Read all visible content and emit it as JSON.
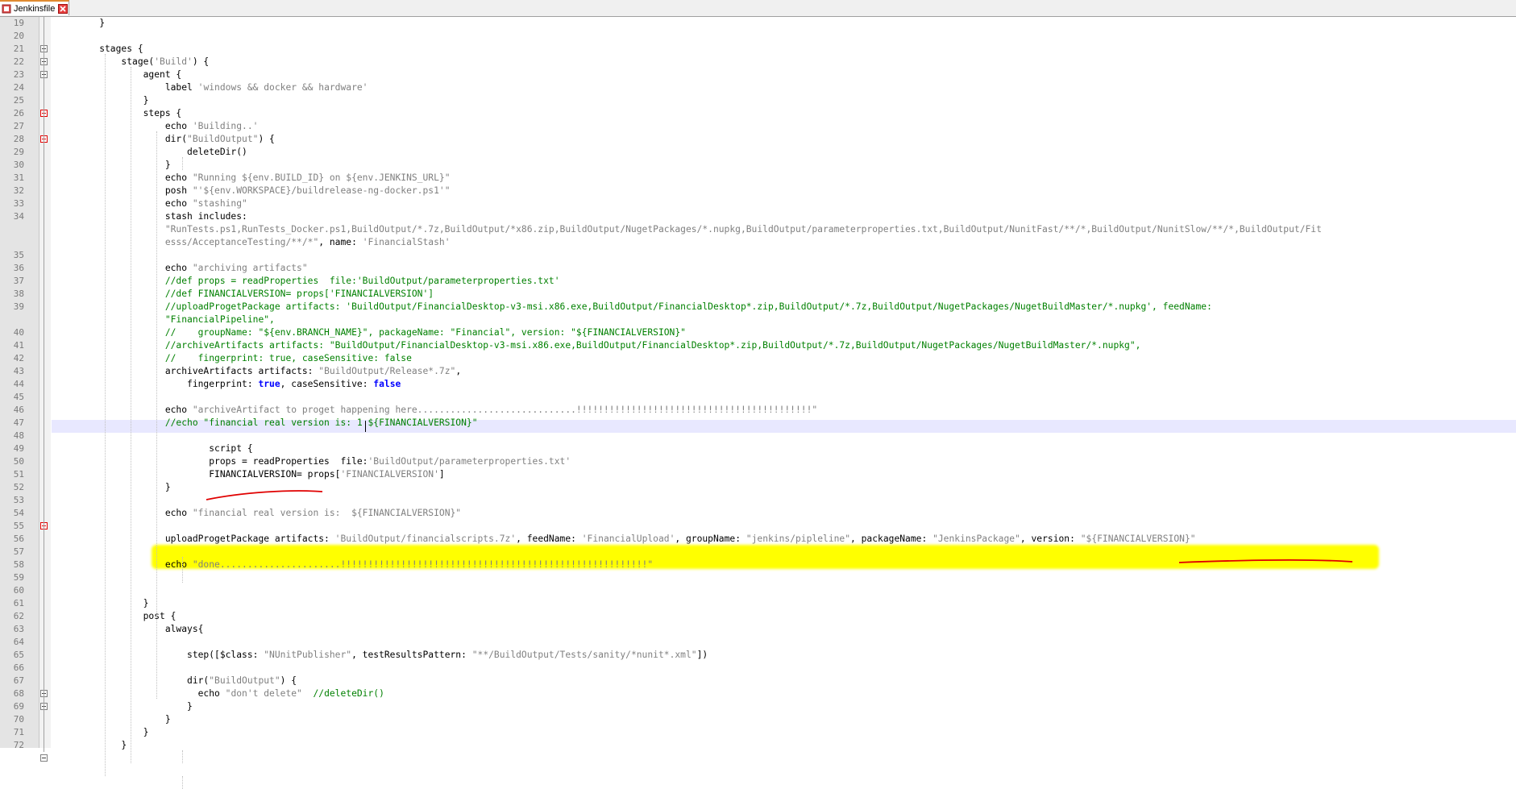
{
  "tab": {
    "title": "Jenkinsfile"
  },
  "lines": [
    {
      "n": "19",
      "parts": [
        [
          "k",
          "    }"
        ]
      ]
    },
    {
      "n": "20",
      "parts": []
    },
    {
      "n": "21",
      "parts": [
        [
          "k",
          "    stages {"
        ]
      ]
    },
    {
      "n": "22",
      "parts": [
        [
          "k",
          "        stage("
        ],
        [
          "s",
          "'Build'"
        ],
        [
          "k",
          ") {"
        ]
      ]
    },
    {
      "n": "23",
      "parts": [
        [
          "k",
          "            agent {"
        ]
      ]
    },
    {
      "n": "24",
      "parts": [
        [
          "k",
          "                label "
        ],
        [
          "s",
          "'windows && docker && hardware'"
        ]
      ]
    },
    {
      "n": "25",
      "parts": [
        [
          "k",
          "            }"
        ]
      ]
    },
    {
      "n": "26",
      "parts": [
        [
          "k",
          "            steps {"
        ]
      ]
    },
    {
      "n": "27",
      "parts": [
        [
          "k",
          "                echo "
        ],
        [
          "s",
          "'Building..'"
        ]
      ]
    },
    {
      "n": "28",
      "parts": [
        [
          "k",
          "                dir("
        ],
        [
          "s",
          "\"BuildOutput\""
        ],
        [
          "k",
          ") {"
        ]
      ]
    },
    {
      "n": "29",
      "parts": [
        [
          "k",
          "                    deleteDir()"
        ]
      ]
    },
    {
      "n": "30",
      "parts": [
        [
          "k",
          "                }"
        ]
      ]
    },
    {
      "n": "31",
      "parts": [
        [
          "k",
          "                echo "
        ],
        [
          "s",
          "\"Running ${env.BUILD_ID} on ${env.JENKINS_URL}\""
        ]
      ]
    },
    {
      "n": "32",
      "parts": [
        [
          "k",
          "                posh "
        ],
        [
          "s",
          "\"'${env.WORKSPACE}/buildrelease-ng-docker.ps1'\""
        ]
      ]
    },
    {
      "n": "33",
      "parts": [
        [
          "k",
          "                echo "
        ],
        [
          "s",
          "\"stashing\""
        ]
      ]
    },
    {
      "n": "34",
      "parts": [
        [
          "k",
          "                stash includes:"
        ]
      ]
    },
    {
      "n": "",
      "parts": [
        [
          "s",
          "                \"RunTests.ps1,RunTests_Docker.ps1,BuildOutput/*.7z,BuildOutput/*x86.zip,BuildOutput/NugetPackages/*.nupkg,BuildOutput/parameterproperties.txt,BuildOutput/NunitFast/**/*,BuildOutput/NunitSlow/**/*,BuildOutput/Fit"
        ]
      ]
    },
    {
      "n": "",
      "parts": [
        [
          "s",
          "                esss/AcceptanceTesting/**/*\""
        ],
        [
          "k",
          ", name: "
        ],
        [
          "s",
          "'FinancialStash'"
        ]
      ]
    },
    {
      "n": "35",
      "parts": []
    },
    {
      "n": "36",
      "parts": [
        [
          "k",
          "                echo "
        ],
        [
          "s",
          "\"archiving artifacts\""
        ]
      ]
    },
    {
      "n": "37",
      "parts": [
        [
          "c",
          "                //def props = readProperties  file:'BuildOutput/parameterproperties.txt'"
        ]
      ]
    },
    {
      "n": "38",
      "parts": [
        [
          "c",
          "                //def FINANCIALVERSION= props['FINANCIALVERSION']"
        ]
      ]
    },
    {
      "n": "39",
      "parts": [
        [
          "c",
          "                //uploadProgetPackage artifacts: 'BuildOutput/FinancialDesktop-v3-msi.x86.exe,BuildOutput/FinancialDesktop*.zip,BuildOutput/*.7z,BuildOutput/NugetPackages/NugetBuildMaster/*.nupkg', feedName:"
        ]
      ]
    },
    {
      "n": "",
      "parts": [
        [
          "c",
          "                \"FinancialPipeline\","
        ]
      ]
    },
    {
      "n": "40",
      "parts": [
        [
          "c",
          "                //    groupName: \"${env.BRANCH_NAME}\", packageName: \"Financial\", version: \"${FINANCIALVERSION}\""
        ]
      ]
    },
    {
      "n": "41",
      "parts": [
        [
          "c",
          "                //archiveArtifacts artifacts: \"BuildOutput/FinancialDesktop-v3-msi.x86.exe,BuildOutput/FinancialDesktop*.zip,BuildOutput/*.7z,BuildOutput/NugetPackages/NugetBuildMaster/*.nupkg\","
        ]
      ]
    },
    {
      "n": "42",
      "parts": [
        [
          "c",
          "                //    fingerprint: true, caseSensitive: false"
        ]
      ]
    },
    {
      "n": "43",
      "parts": [
        [
          "k",
          "                archiveArtifacts artifacts: "
        ],
        [
          "s",
          "\"BuildOutput/Release*.7z\""
        ],
        [
          "k",
          ","
        ]
      ]
    },
    {
      "n": "44",
      "parts": [
        [
          "k",
          "                    fingerprint: "
        ],
        [
          "b",
          "true"
        ],
        [
          "k",
          ", caseSensitive: "
        ],
        [
          "b",
          "false"
        ]
      ]
    },
    {
      "n": "45",
      "parts": []
    },
    {
      "n": "46",
      "parts": [
        [
          "k",
          "                echo "
        ],
        [
          "s",
          "\"archiveArtifact to proget happening here.............................!!!!!!!!!!!!!!!!!!!!!!!!!!!!!!!!!!!!!!!!!!!\""
        ]
      ]
    },
    {
      "n": "47",
      "parts": [
        [
          "c",
          "                //echo \"financial real version is: 1 ${FINANCIALVERSION}\""
        ]
      ]
    },
    {
      "n": "48",
      "parts": []
    },
    {
      "n": "49",
      "parts": [
        [
          "k",
          "                        script {"
        ]
      ]
    },
    {
      "n": "50",
      "parts": [
        [
          "k",
          "                        props = readProperties  file:"
        ],
        [
          "s",
          "'BuildOutput/parameterproperties.txt'"
        ]
      ]
    },
    {
      "n": "51",
      "parts": [
        [
          "k",
          "                        FINANCIALVERSION= props["
        ],
        [
          "s",
          "'FINANCIALVERSION'"
        ],
        [
          "k",
          "]"
        ]
      ]
    },
    {
      "n": "52",
      "parts": [
        [
          "k",
          "                }"
        ]
      ]
    },
    {
      "n": "53",
      "parts": []
    },
    {
      "n": "54",
      "parts": [
        [
          "k",
          "                echo "
        ],
        [
          "s",
          "\"financial real version is:  ${FINANCIALVERSION}\""
        ]
      ]
    },
    {
      "n": "55",
      "parts": []
    },
    {
      "n": "56",
      "parts": [
        [
          "k",
          "                uploadProgetPackage artifacts: "
        ],
        [
          "s",
          "'BuildOutput/financialscripts.7z'"
        ],
        [
          "k",
          ", feedName: "
        ],
        [
          "s",
          "'FinancialUpload'"
        ],
        [
          "k",
          ", groupName: "
        ],
        [
          "s",
          "\"jenkins/pipleline\""
        ],
        [
          "k",
          ", packageName: "
        ],
        [
          "s",
          "\"JenkinsPackage\""
        ],
        [
          "k",
          ", version: "
        ],
        [
          "s",
          "\"${FINANCIALVERSION}\""
        ]
      ]
    },
    {
      "n": "57",
      "parts": []
    },
    {
      "n": "58",
      "parts": [
        [
          "k",
          "                echo "
        ],
        [
          "s",
          "\"done......................!!!!!!!!!!!!!!!!!!!!!!!!!!!!!!!!!!!!!!!!!!!!!!!!!!!!!!!!\""
        ]
      ]
    },
    {
      "n": "59",
      "parts": []
    },
    {
      "n": "60",
      "parts": []
    },
    {
      "n": "61",
      "parts": [
        [
          "k",
          "            }"
        ]
      ]
    },
    {
      "n": "62",
      "parts": [
        [
          "k",
          "            post {"
        ]
      ]
    },
    {
      "n": "63",
      "parts": [
        [
          "k",
          "                always{"
        ]
      ]
    },
    {
      "n": "64",
      "parts": []
    },
    {
      "n": "65",
      "parts": [
        [
          "k",
          "                    step([$class: "
        ],
        [
          "s",
          "\"NUnitPublisher\""
        ],
        [
          "k",
          ", testResultsPattern: "
        ],
        [
          "s",
          "\"**/BuildOutput/Tests/sanity/*nunit*.xml\""
        ],
        [
          "k",
          "])"
        ]
      ]
    },
    {
      "n": "66",
      "parts": []
    },
    {
      "n": "67",
      "parts": [
        [
          "k",
          "                    dir("
        ],
        [
          "s",
          "\"BuildOutput\""
        ],
        [
          "k",
          ") {"
        ]
      ]
    },
    {
      "n": "68",
      "parts": [
        [
          "k",
          "                      echo "
        ],
        [
          "s",
          "\"don't delete\""
        ],
        [
          "k",
          "  "
        ],
        [
          "c",
          "//deleteDir()"
        ]
      ]
    },
    {
      "n": "69",
      "parts": [
        [
          "k",
          "                    }"
        ]
      ]
    },
    {
      "n": "70",
      "parts": [
        [
          "k",
          "                }"
        ]
      ]
    },
    {
      "n": "71",
      "parts": [
        [
          "k",
          "            }"
        ]
      ]
    },
    {
      "n": "72",
      "parts": [
        [
          "k",
          "        }"
        ]
      ]
    }
  ]
}
